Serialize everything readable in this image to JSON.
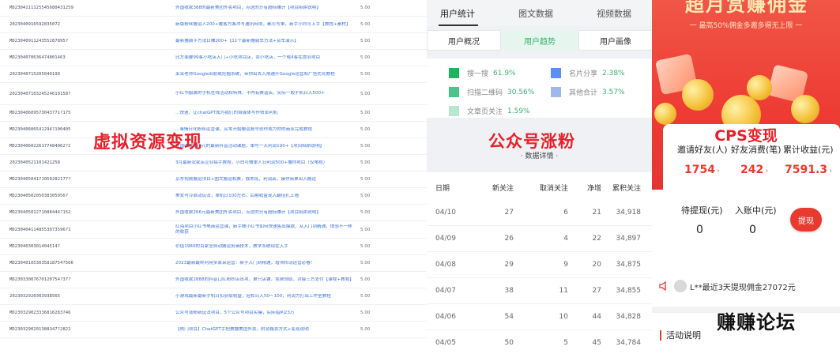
{
  "left": {
    "orders": [
      {
        "id": "MD2304111125545680431259",
        "title": "外国收款388的最新美团外卖项目，点这的分有超标赚计【项目陷阱说明】",
        "amount": "5.00"
      },
      {
        "id": "2023040916592835072",
        "title": "新版粉丝搬运人200+暖客方面冲写通讯网项，都可写单，新手小白可上手【教程+素材】",
        "amount": "5.00"
      },
      {
        "id": "MD2304091124355287895?",
        "title": "最新撸骑手方法日赚200+【11个最新撸骑车方法+赏车演示】",
        "amount": "5.00"
      },
      {
        "id": "MD2304070636474801463",
        "title": "比方面要99客小吃店入门+小吃项目店，卖小吃店，一个或4客在提到项目",
        "amount": "5.00"
      },
      {
        "id": "2023040715205040199",
        "title": "呆呆老师Google出航或挖掘系统，带你出去入限通升Google运营和广告优化教程",
        "amount": "5.00"
      },
      {
        "id": "2023040710324524619158?",
        "title": "小红书服装的手机在线活动和特殊，不内有赛道店，实际一般手机日入500+",
        "amount": "5.00"
      },
      {
        "id": "MD23040609573043771?175",
        "title": "...快速，让chatGPT成为我们的自媒体写作效率利机",
        "amount": "5.00"
      },
      {
        "id": "MD23040606541294?100405",
        "title": "...事情日化粉丝运营课，从零开始搬运账号创作成为你的商业完成教程",
        "amount": "5.00"
      },
      {
        "id": "MD2304060226177484062?2",
        "title": "外国收款558元的最新抖音活动课题，单号一天利润100+【项目陷阱说明】",
        "amount": "5.00"
      },
      {
        "id": "2023040521101421258",
        "title": "3月最新农家店企业搞手教程，小白可做单人日利润500+撸你项目（仅电视）",
        "amount": "5.00"
      },
      {
        "id": "MD23040504171050282177?",
        "title": "京东视频搬运项目+图文搬运和赛，成本低，利润高，操作简单出入搬运",
        "amount": "5.00"
      },
      {
        "id": "MD2304050205038305956?",
        "title": "美女号冷启动玩法，单机日100左右，后期收益现入翻倍扎上墙",
        "amount": "5.00"
      },
      {
        "id": "MD23040501271088444?152",
        "title": "外国收款266元最新美团外卖项目，点这的分有超标赚计【项目陷阱说明】",
        "amount": "5.00"
      },
      {
        "id": "MD2304041148553073596?1",
        "title": "红海项目小红书电商运营课，新手做小红书如何快速售出爆款，从入门到精通，体验不一样的收获",
        "amount": "5.00"
      },
      {
        "id": "MD2304030301404514?",
        "title": "价值1980的百家全自动搬运剪辑技术，教学系统现在入手",
        "amount": "5.00"
      },
      {
        "id": "MD230401053035818754?566",
        "title": "2023最新最终利用多家采运营：新手入门到精通，增项转动运营必看!",
        "amount": "5.00"
      },
      {
        "id": "MD23033007670120754?37?",
        "title": "外国收款2888的抖音口红粉抄店出项，单只店铺，免费领取，对接三方支付【课程+教程】",
        "amount": "5.00"
      },
      {
        "id": "2023032920303938565",
        "title": "小游戏最新最新手机日扣获取收益，轻松日入50～100，利润力打出工作室教程",
        "amount": "5.00"
      },
      {
        "id": "MD230329023336816283?46",
        "title": "公众号涨粉新玩法项目，5个公众号项目实操，实际指利23万",
        "amount": "5.00"
      },
      {
        "id": "MD2303290201388347?2822",
        "title": "【热门项目】ChatGPT手把教撸美团外卖，附资格卖方式+变现说明",
        "amount": "5.00"
      }
    ],
    "overlay_text": "虚拟资源变现"
  },
  "mid": {
    "tabs": [
      "用户统计",
      "图文数据",
      "视频数据"
    ],
    "subtabs": [
      "用户概况",
      "用户趋势",
      "用户画像"
    ],
    "legend": [
      {
        "label": "搜一搜",
        "pct": "61.9%",
        "color": "#1fb35f"
      },
      {
        "label": "名片分享",
        "pct": "2.38%",
        "color": "#5b8ff5"
      },
      {
        "label": "扫描二维码",
        "pct": "30.56%",
        "color": "#4bc48a"
      },
      {
        "label": "其他合计",
        "pct": "3.57%",
        "color": "#9fb7ef"
      },
      {
        "label": "文章页关注",
        "pct": "1.59%",
        "color": "#b6e7cf"
      }
    ],
    "overlay_text": "公众号涨粉",
    "detail_title": "· 数据详情 ·",
    "table": {
      "headers": [
        "日期",
        "新关注",
        "取消关注",
        "净增",
        "累积关注"
      ],
      "rows": [
        [
          "04/10",
          "27",
          "6",
          "21",
          "34,918"
        ],
        [
          "04/09",
          "26",
          "4",
          "22",
          "34,897"
        ],
        [
          "04/08",
          "29",
          "9",
          "20",
          "34,875"
        ],
        [
          "04/07",
          "38",
          "11",
          "27",
          "34,855"
        ],
        [
          "04/06",
          "54",
          "10",
          "44",
          "34,828"
        ],
        [
          "04/05",
          "50",
          "5",
          "45",
          "34,784"
        ]
      ]
    }
  },
  "right": {
    "banner_title": "超月赏赚佣金",
    "banner_sub": "一 最高50%佣金多邀多得无上限 一",
    "cps_title": "CPS变现",
    "stats": [
      {
        "label": "邀请好友(人)",
        "value": "1754"
      },
      {
        "label": "好友消费(笔)",
        "value": "242"
      },
      {
        "label": "累计收益(元)",
        "value": "7591.3"
      }
    ],
    "pending": [
      {
        "label": "待提现(元)",
        "value": "0"
      },
      {
        "label": "入账中(元)",
        "value": "0"
      }
    ],
    "withdraw_label": "提现",
    "notice": "L**最近3天提现佣金27072元",
    "activity_label": "活动说明",
    "overlay_text": "赚赚论坛",
    "accent": "#e83a2e"
  }
}
